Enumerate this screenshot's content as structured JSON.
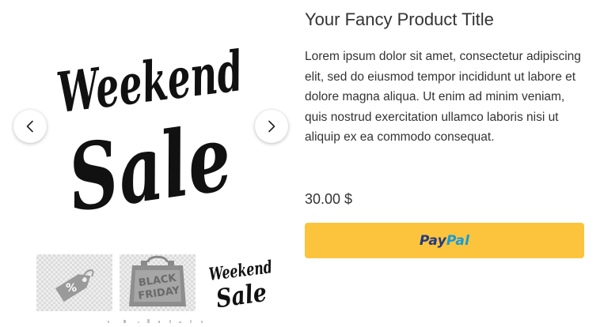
{
  "product": {
    "title": "Your Fancy Product Title",
    "description": "Lorem ipsum dolor sit amet, consectetur adipiscing elit, sed do eiusmod tempor incididunt ut labore et dolore magna aliqua. Ut enim ad minim veniam, quis nostrud exercitation ullamco laboris nisi ut aliquip ex ea commodo consequat.",
    "price": "30.00 $"
  },
  "gallery": {
    "main_image": {
      "line1": "Weekend",
      "line2": "Sale"
    },
    "prev_icon": "chevron-left-icon",
    "next_icon": "chevron-right-icon",
    "thumbnails": [
      {
        "icon": "discount-tag-icon",
        "text": "%"
      },
      {
        "icon": "black-friday-bag-icon",
        "line1": "BLACK",
        "line2": "FRIDAY"
      },
      {
        "icon": "weekend-sale-lettering",
        "line1": "Weekend",
        "line2": "Sale"
      }
    ]
  },
  "paypal": {
    "pay": "Pay",
    "pal": "Pal"
  },
  "colors": {
    "paypal_button": "#fcc43d",
    "paypal_dark": "#253b80",
    "paypal_light": "#179bd7",
    "text": "#333333"
  }
}
